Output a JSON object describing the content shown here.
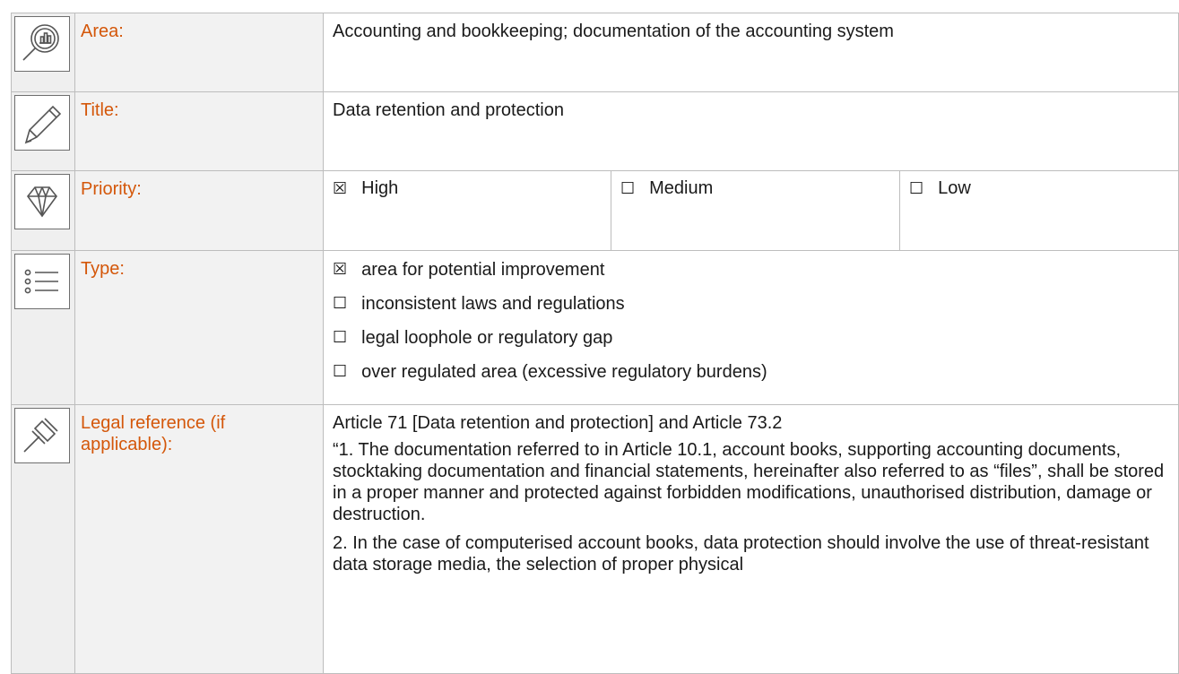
{
  "rows": {
    "area": {
      "label": "Area:",
      "value": "Accounting and bookkeeping; documentation of the accounting system"
    },
    "title": {
      "label": "Title:",
      "value": "Data retention and protection"
    },
    "priority": {
      "label": "Priority:",
      "options": [
        {
          "mark": "☒",
          "label": "High"
        },
        {
          "mark": "☐",
          "label": "Medium"
        },
        {
          "mark": "☐",
          "label": "Low"
        }
      ]
    },
    "type": {
      "label": "Type:",
      "options": [
        {
          "mark": "☒",
          "label": "area for potential improvement"
        },
        {
          "mark": "☐",
          "label": "inconsistent laws and regulations"
        },
        {
          "mark": "☐",
          "label": "legal loophole or regulatory gap"
        },
        {
          "mark": "☐",
          "label": "over regulated area (excessive regulatory burdens)"
        }
      ]
    },
    "legal": {
      "label": "Legal reference (if applicable):",
      "paragraphs": [
        "Article 71 [Data retention and protection] and Article 73.2",
        "“1. The documentation referred to in Article 10.1, account books, supporting accounting documents, stocktaking documentation and financial statements, hereinafter also referred to as “files”, shall be stored in a proper manner and protected against forbidden modifications, unauthorised distribution, damage or destruction.",
        "2. In the case of computerised account books, data protection should involve the use of threat-resistant data storage media, the selection of proper physical"
      ]
    }
  },
  "icons": {
    "area": "magnifier-chart-icon",
    "title": "pencil-icon",
    "priority": "diamond-icon",
    "type": "list-icon",
    "legal": "gavel-icon"
  },
  "colors": {
    "label": "#d4570a",
    "label_bg": "#f2f2f2",
    "border": "#bdbdbd"
  }
}
